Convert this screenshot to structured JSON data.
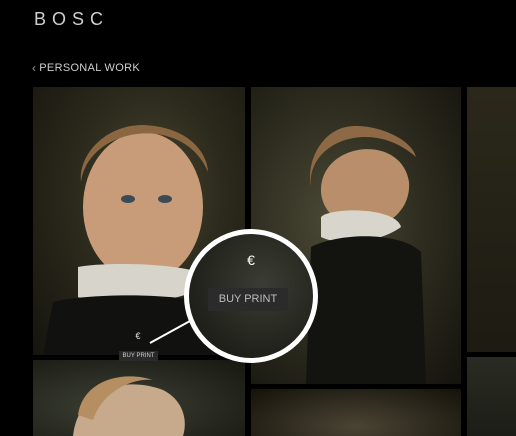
{
  "brand": {
    "name": "BOSC"
  },
  "nav": {
    "back_label": "PERSONAL WORK"
  },
  "gallery": {
    "featured": {
      "price_icon": "euro-icon",
      "price_symbol": "€",
      "buy_label": "BUY PRINT"
    },
    "zoom": {
      "price_symbol": "€",
      "buy_label": "BUY PRINT"
    }
  },
  "colors": {
    "background": "#000000",
    "text": "#cfcfcf",
    "zoom_ring": "#ffffff"
  }
}
